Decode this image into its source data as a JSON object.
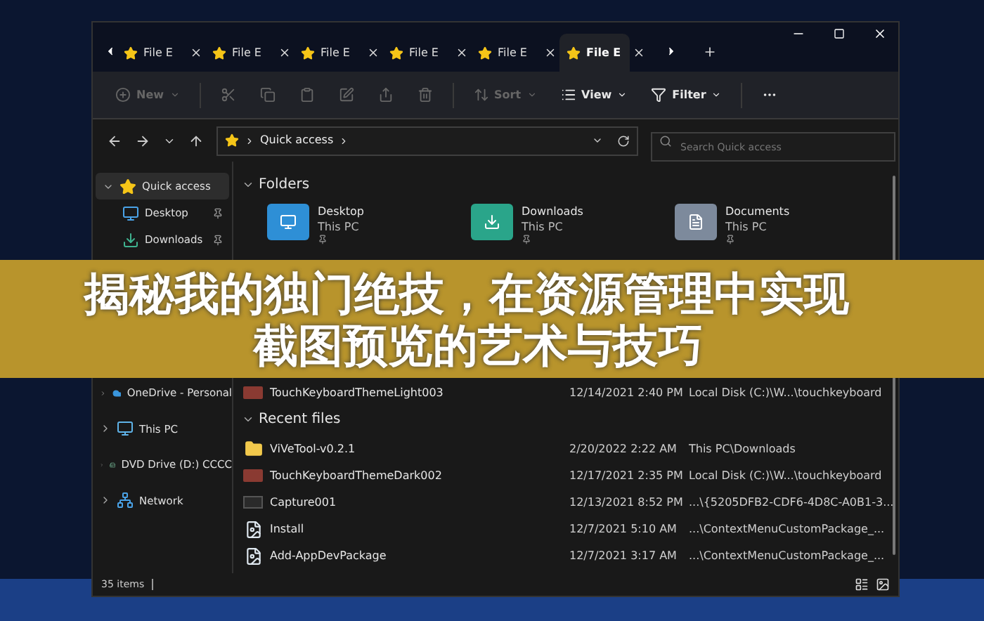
{
  "tabs": [
    {
      "label": "File E",
      "selected": false
    },
    {
      "label": "File E",
      "selected": false
    },
    {
      "label": "File E",
      "selected": false
    },
    {
      "label": "File E",
      "selected": false
    },
    {
      "label": "File E",
      "selected": false
    },
    {
      "label": "File E",
      "selected": true
    }
  ],
  "toolbar": [
    {
      "kind": "new",
      "label": "New",
      "disabled": true
    },
    {
      "kind": "cut",
      "disabled": true
    },
    {
      "kind": "copy",
      "disabled": true
    },
    {
      "kind": "paste",
      "disabled": true
    },
    {
      "kind": "rename",
      "disabled": true
    },
    {
      "kind": "share",
      "disabled": true
    },
    {
      "kind": "delete",
      "disabled": true
    },
    {
      "kind": "sort",
      "label": "Sort",
      "disabled": true
    },
    {
      "kind": "view",
      "label": "View",
      "disabled": false
    },
    {
      "kind": "filter",
      "label": "Filter",
      "disabled": false
    },
    {
      "kind": "more",
      "disabled": false
    }
  ],
  "address": {
    "path": "Quick access",
    "search_placeholder": "Search Quick access"
  },
  "sidebar": {
    "quick_access": [
      {
        "kind": "star",
        "label": "Quick access",
        "expanded": true,
        "selected": true,
        "pinned": false
      },
      {
        "kind": "desktop",
        "label": "Desktop",
        "selected": false,
        "pinned": true
      },
      {
        "kind": "download",
        "label": "Downloads",
        "selected": false,
        "pinned": true
      }
    ],
    "locations": [
      {
        "kind": "cloud",
        "label": "OneDrive - Personal",
        "expanded": false,
        "selected": false,
        "pinned": false
      },
      {
        "kind": "pc",
        "label": "This PC",
        "expanded": false,
        "selected": false,
        "pinned": false
      },
      {
        "kind": "drive",
        "label": "DVD Drive (D:) CCCC",
        "expanded": false,
        "selected": false,
        "pinned": false
      },
      {
        "kind": "network",
        "label": "Network",
        "expanded": false,
        "selected": false,
        "pinned": false
      }
    ]
  },
  "folders": {
    "header": "Folders",
    "expanded": true,
    "tiles": [
      {
        "kind": "desktop",
        "name": "Desktop",
        "location": "This PC",
        "pinned": true
      },
      {
        "kind": "download",
        "name": "Downloads",
        "location": "This PC",
        "pinned": true
      },
      {
        "kind": "documents",
        "name": "Documents",
        "location": "This PC",
        "pinned": true
      }
    ],
    "rows": [
      {
        "kind": "image",
        "name": "TouchKeyboardThemeLight003",
        "date": "12/14/2021 2:40 PM",
        "location": "Local Disk (C:)\\W...\\touchkeyboard"
      }
    ]
  },
  "recent": {
    "header": "Recent files",
    "expanded": true,
    "rows": [
      {
        "kind": "folder",
        "name": "ViVeTool-v0.2.1",
        "date": "2/20/2022 2:22 AM",
        "location": "This PC\\Downloads"
      },
      {
        "kind": "image",
        "name": "TouchKeyboardThemeDark002",
        "date": "12/17/2021 2:35 PM",
        "location": "Local Disk (C:)\\W...\\touchkeyboard"
      },
      {
        "kind": "photo",
        "name": "Capture001",
        "date": "12/13/2021 8:52 PM",
        "location": "...\\{5205DFB2-CDF6-4D8C-A0B1-3..."
      },
      {
        "kind": "doc",
        "name": "Install",
        "date": "12/7/2021 5:10 AM",
        "location": "...\\ContextMenuCustomPackage_..."
      },
      {
        "kind": "doc",
        "name": "Add-AppDevPackage",
        "date": "12/7/2021 3:17 AM",
        "location": "...\\ContextMenuCustomPackage_..."
      }
    ]
  },
  "status_bar": {
    "count": "35 items"
  },
  "banner": {
    "lines": [
      "揭秘我的独门绝技，在资源管理中实现",
      "截图预览的艺术与技巧"
    ]
  }
}
